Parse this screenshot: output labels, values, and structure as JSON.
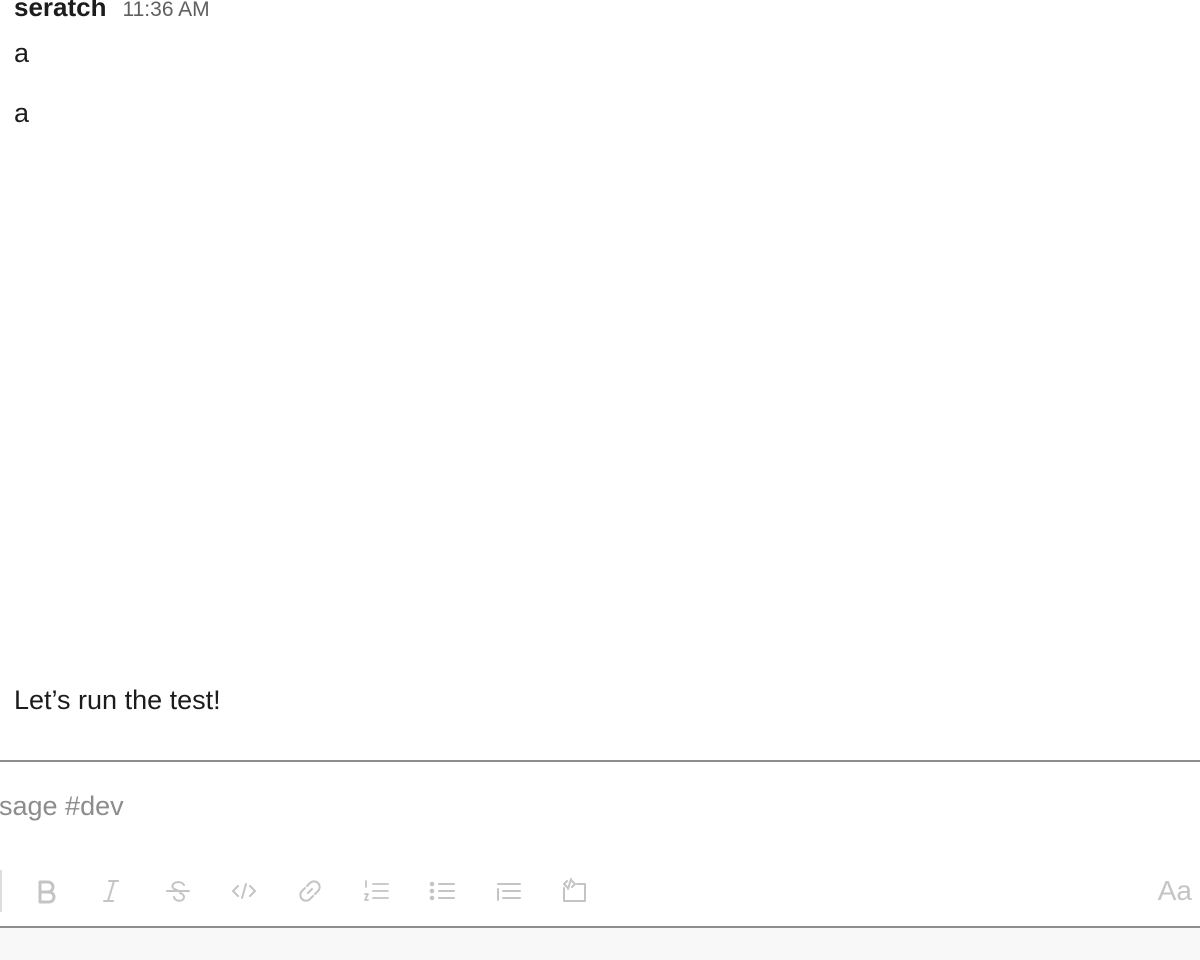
{
  "message": {
    "author": "seratch",
    "timestamp": "11:36 AM",
    "lines": [
      "a",
      "a"
    ]
  },
  "followup_message": "Let’s run the test!",
  "composer": {
    "placeholder": "Message #dev",
    "value": ""
  },
  "toolbar": {
    "tools": [
      {
        "name": "bold",
        "icon": "bold-icon"
      },
      {
        "name": "italic",
        "icon": "italic-icon"
      },
      {
        "name": "strikethrough",
        "icon": "strikethrough-icon"
      },
      {
        "name": "code",
        "icon": "code-icon"
      },
      {
        "name": "link",
        "icon": "link-icon"
      },
      {
        "name": "ordered-list",
        "icon": "ordered-list-icon"
      },
      {
        "name": "bulleted-list",
        "icon": "bulleted-list-icon"
      },
      {
        "name": "blockquote",
        "icon": "blockquote-icon"
      },
      {
        "name": "code-block",
        "icon": "code-block-icon"
      }
    ],
    "format_toggle_label": "Aa"
  },
  "colors": {
    "text": "#1d1c1d",
    "muted_text": "#616061",
    "placeholder": "#8c8c8c",
    "toolbar_icon": "#c4c4c4",
    "divider": "#8d8d8d"
  }
}
